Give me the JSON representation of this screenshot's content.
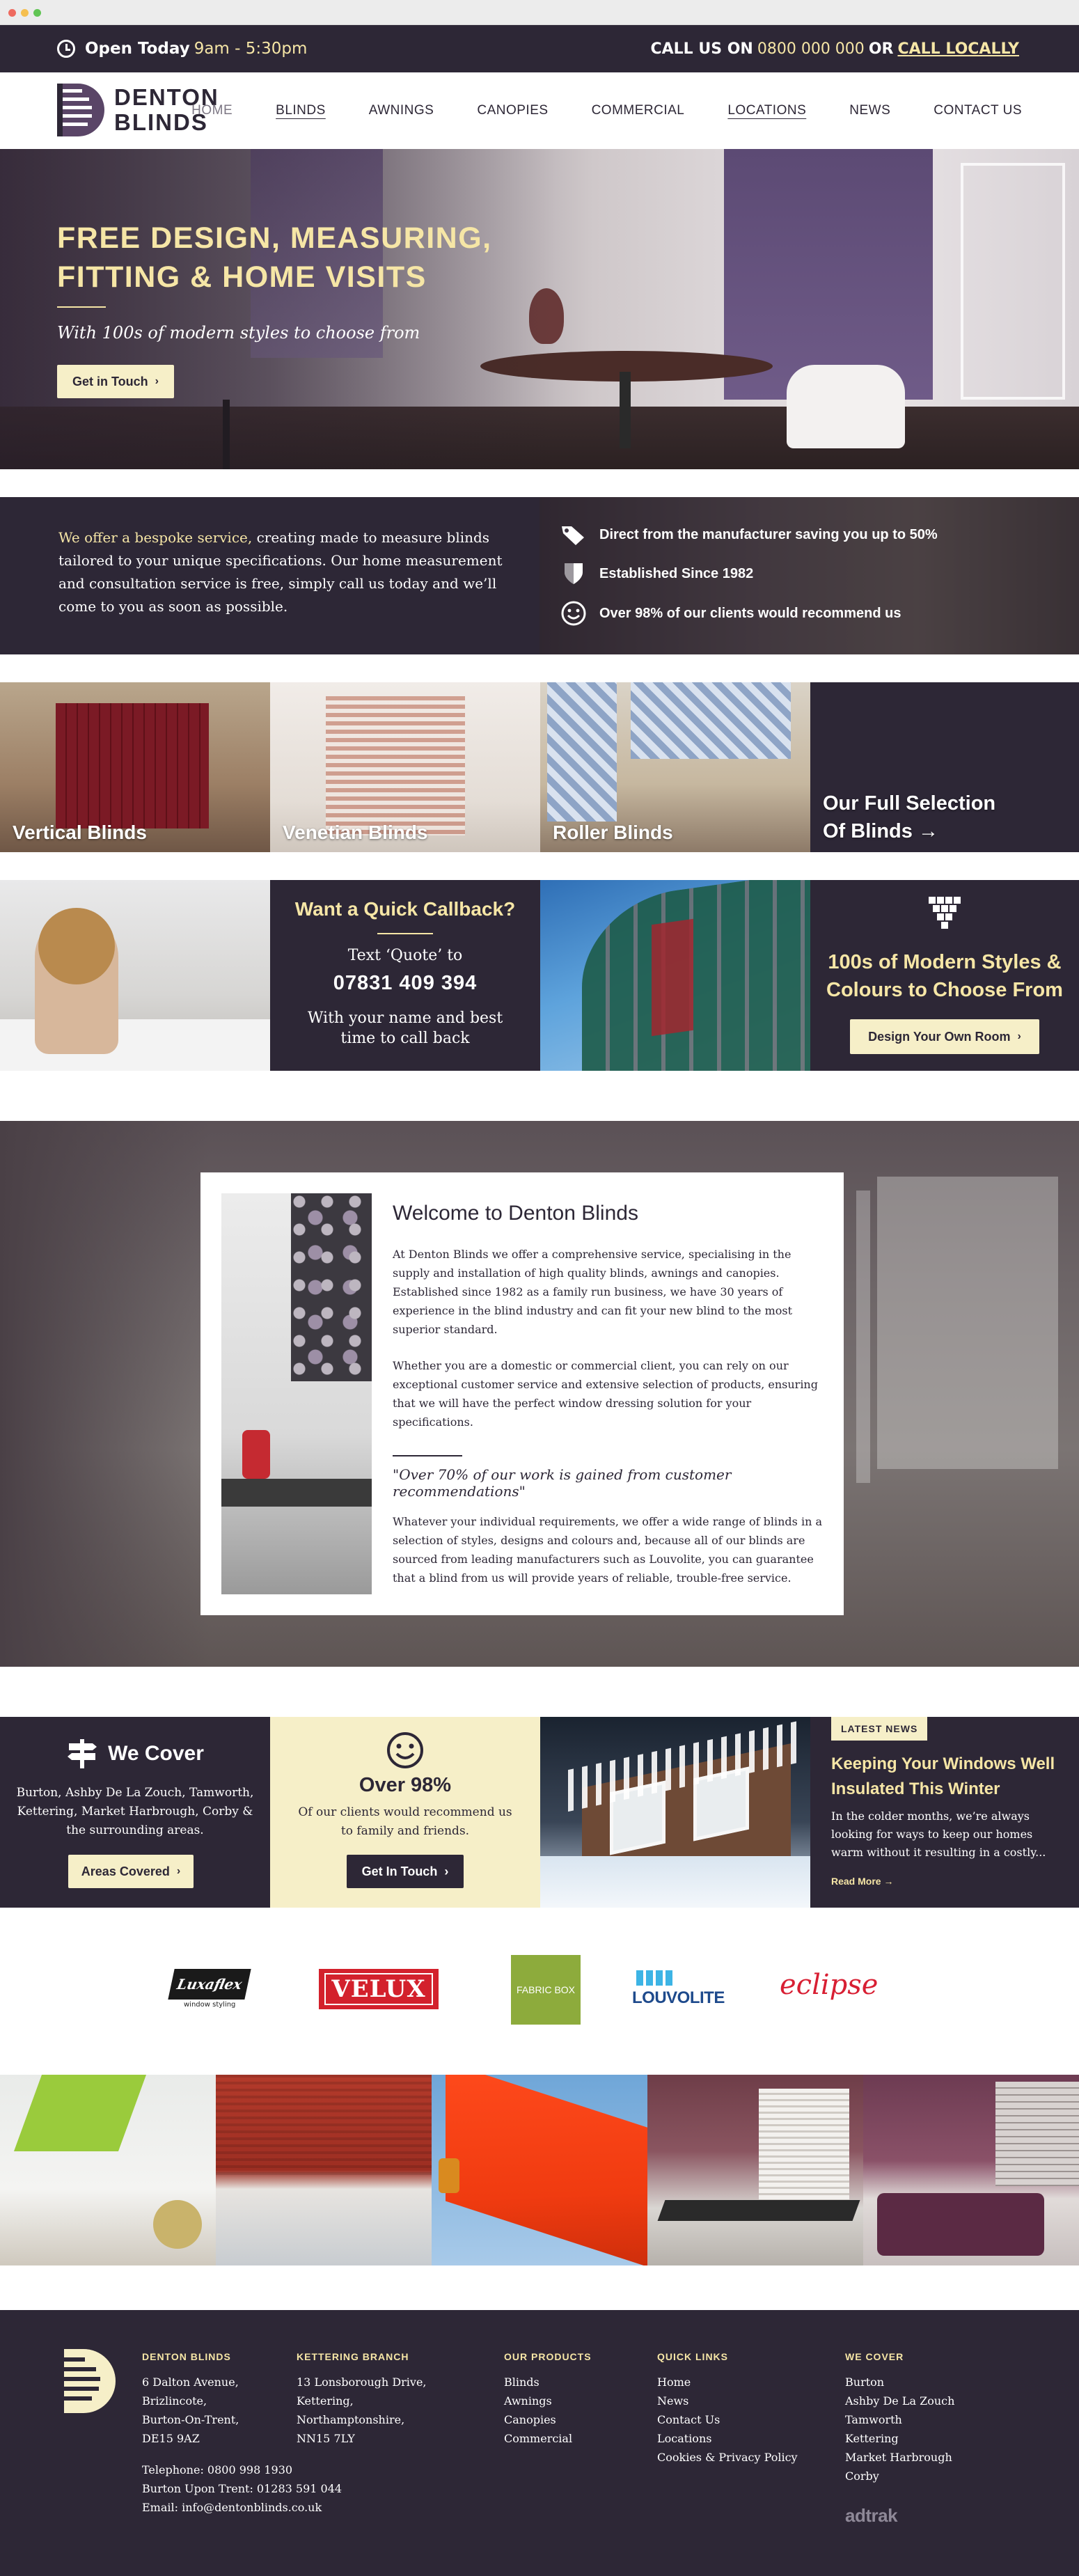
{
  "topbar": {
    "hours_label": "Open Today",
    "hours_value": "9am - 5:30pm",
    "call_prefix": "CALL US ON",
    "phone": "0800 000 000",
    "or": "OR",
    "call_locally": "CALL LOCALLY"
  },
  "header": {
    "logo_line1": "DENTON",
    "logo_line2": "BLINDS",
    "nav": [
      "HOME",
      "BLINDS",
      "AWNINGS",
      "CANOPIES",
      "COMMERCIAL",
      "LOCATIONS",
      "NEWS",
      "CONTACT US"
    ]
  },
  "hero": {
    "title": "FREE DESIGN, MEASURING, FITTING & HOME VISITS",
    "subtitle": "With 100s of modern styles to choose from",
    "cta": "Get in Touch"
  },
  "bespoke": {
    "highlight": "We offer a bespoke service,",
    "text": " creating made to measure blinds tailored to your unique specifications. Our home measurement and consultation service is free, simply call us today and we’ll come to you as soon as possible.",
    "features": [
      "Direct from the manufacturer saving you up to 50%",
      "Established Since 1982",
      "Over 98% of our clients would recommend us"
    ]
  },
  "products": {
    "vertical": "Vertical Blinds",
    "venetian": "Venetian Blinds",
    "roller": "Roller Blinds",
    "full_line1": "Our Full Selection",
    "full_line2": "Of Blinds →"
  },
  "callback": {
    "title": "Want a Quick Callback?",
    "line1": "Text ‘Quote’ to",
    "number": "07831 409 394",
    "line2": "With your name and best time to call back"
  },
  "styles": {
    "title": "100s of Modern Styles & Colours to Choose From",
    "cta": "Design Your Own Room"
  },
  "welcome": {
    "title": "Welcome to Denton Blinds",
    "p1": "At Denton Blinds we offer a comprehensive service, specialising in the supply and installation of high quality blinds, awnings and canopies. Established since 1982 as a family run business, we have 30 years of experience in the blind industry and can fit your new blind to the most superior standard.",
    "p2": "Whether you are a domestic or commercial client, you can rely on our exceptional customer service and extensive selection of products, ensuring that we will have the perfect window dressing solution for your specifications.",
    "quote": "\"Over 70% of our work is gained from customer recommendations\"",
    "p3": "Whatever your individual requirements, we offer a wide range of blinds in a selection of styles, designs and colours and, because all of our blinds are sourced from leading manufacturers such as Louvolite, you can guarantee that a blind from us will provide years of reliable, trouble-free service."
  },
  "cover": {
    "title": "We Cover",
    "text": "Burton, Ashby De La Zouch, Tamworth, Kettering, Market Harbrough, Corby & the surrounding areas.",
    "cta": "Areas Covered"
  },
  "happy": {
    "title": "Over 98%",
    "text": "Of our clients would recommend us to family and friends.",
    "cta": "Get In Touch"
  },
  "news": {
    "badge": "LATEST NEWS",
    "title": "Keeping Your Windows Well Insulated This Winter",
    "excerpt": "In the colder months, we’re always looking for ways to keep our homes warm without it resulting in a costly...",
    "more": "Read More →"
  },
  "brands": {
    "luxaflex": "Luxaflex",
    "luxaflex_tag": "window styling",
    "velux": "VELUX",
    "fabricbox": "FABRIC BOX",
    "louvolite": "LOUVOLITE",
    "eclipse": "eclipse"
  },
  "footer": {
    "col1": {
      "heading": "DENTON BLINDS",
      "address": [
        "6 Dalton Avenue,",
        "Brizlincote,",
        "Burton-On-Trent,",
        "DE15 9AZ"
      ],
      "contact": [
        "Telephone: 0800 998 1930",
        "Burton Upon Trent: 01283 591 044",
        "Email: info@dentonblinds.co.uk"
      ]
    },
    "col2": {
      "heading": "KETTERING BRANCH",
      "address": [
        "13 Lonsborough Drive,",
        "Kettering,",
        "Northamptonshire,",
        "NN15 7LY"
      ]
    },
    "col3": {
      "heading": "OUR PRODUCTS",
      "links": [
        "Blinds",
        "Awnings",
        "Canopies",
        "Commercial"
      ]
    },
    "col4": {
      "heading": "QUICK LINKS",
      "links": [
        "Home",
        "News",
        "Contact Us",
        "Locations",
        "Cookies & Privacy Policy"
      ]
    },
    "col5": {
      "heading": "WE COVER",
      "links": [
        "Burton",
        "Ashby De La Zouch",
        "Tamworth",
        "Kettering",
        "Market Harbrough",
        "Corby"
      ]
    },
    "credit": "adtrak"
  },
  "colors": {
    "brand_dark": "#2d2736",
    "accent_cream": "#f6e6a6",
    "button_cream": "#f6efc8"
  }
}
